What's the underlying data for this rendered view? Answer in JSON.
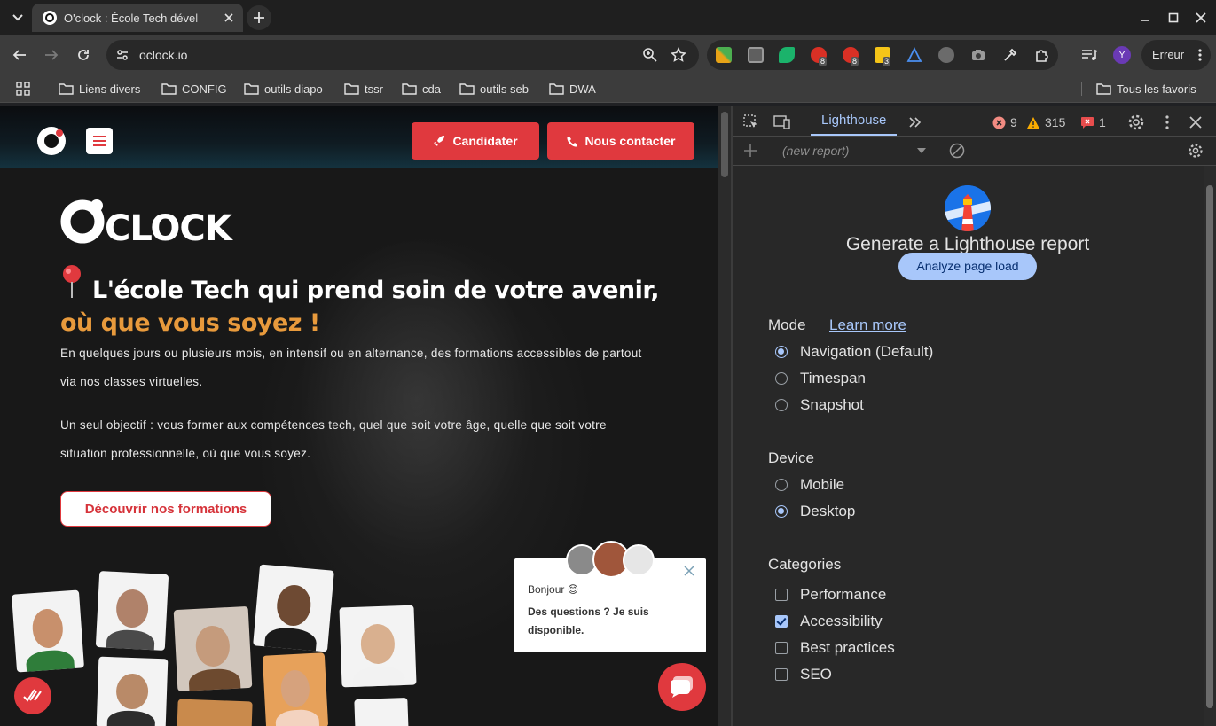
{
  "browser": {
    "tab_title": "O'clock : École Tech dével",
    "url": "oclock.io",
    "error_button": "Erreur",
    "profile_initial": "Y",
    "extension_badges": [
      "8",
      "8",
      "3"
    ],
    "bookmarks": [
      "Liens divers",
      "CONFIG",
      "outils diapo",
      "tssr",
      "cda",
      "outils seb",
      "DWA"
    ],
    "all_bookmarks": "Tous les favoris"
  },
  "site": {
    "apply_button": "Candidater",
    "contact_button": "Nous contacter",
    "headline_main": "L'école Tech qui prend soin de votre avenir,",
    "headline_accent": "où que vous soyez !",
    "paragraph_1": "En quelques jours ou plusieurs mois, en intensif ou en alternance, des formations accessibles de partout via nos classes virtuelles.",
    "paragraph_2": "Un seul objectif : vous former aux compétences tech, quel que soit votre âge, quelle que soit votre situation professionnelle, où que vous soyez.",
    "discover_button": "Découvrir nos formations",
    "chat_greeting": "Bonjour 😊",
    "chat_question": "Des questions ? Je suis disponible."
  },
  "devtools": {
    "active_tab": "Lighthouse",
    "errors_count": "9",
    "warnings_count": "315",
    "issues_count": "1",
    "report_select": "(new report)",
    "title": "Generate a Lighthouse report",
    "analyze_button": "Analyze page load",
    "mode_heading": "Mode",
    "learn_more": "Learn more",
    "modes": [
      {
        "label": "Navigation (Default)",
        "selected": true
      },
      {
        "label": "Timespan",
        "selected": false
      },
      {
        "label": "Snapshot",
        "selected": false
      }
    ],
    "device_heading": "Device",
    "devices": [
      {
        "label": "Mobile",
        "selected": false
      },
      {
        "label": "Desktop",
        "selected": true
      }
    ],
    "categories_heading": "Categories",
    "categories": [
      {
        "label": "Performance",
        "checked": false
      },
      {
        "label": "Accessibility",
        "checked": true
      },
      {
        "label": "Best practices",
        "checked": false
      },
      {
        "label": "SEO",
        "checked": false
      }
    ]
  },
  "colors": {
    "brand_red": "#e0393e",
    "accent_orange": "#e89a3c",
    "devtools_blue": "#a8c7fa"
  }
}
